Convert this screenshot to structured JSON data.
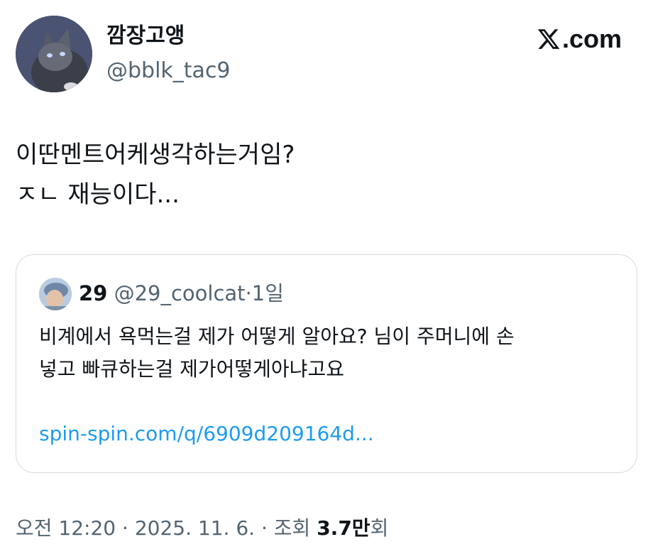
{
  "author": {
    "display_name": "깜장고앵",
    "handle": "@bblk_tac9",
    "avatar_icon": "cat-avatar"
  },
  "brand": {
    "icon": "x-logo-icon",
    "text": ".com"
  },
  "tweet": {
    "lines": [
      "이딴멘트어케생각하는거임?",
      "ㅈㄴ 재능이다..."
    ]
  },
  "quote": {
    "name": "29",
    "handle": "@29_coolcat",
    "separator": "·",
    "time": "1일",
    "lines": [
      "비계에서 욕먹는걸 제가 어떻게 알아요? 님이 주머니에 손",
      "넣고 빠큐하는걸 제가어떻게아냐고요"
    ],
    "link": "spin-spin.com/q/6909d209164d..."
  },
  "meta": {
    "time": "오전 12:20",
    "sep1": "·",
    "date": "2025. 11. 6.",
    "sep2": "·",
    "views_label": "조회",
    "views_count": "3.7만",
    "views_suffix": "회"
  },
  "colors": {
    "text": "#0f1419",
    "secondary": "#536471",
    "link": "#1d9bf0",
    "border": "#d6dbdf"
  }
}
